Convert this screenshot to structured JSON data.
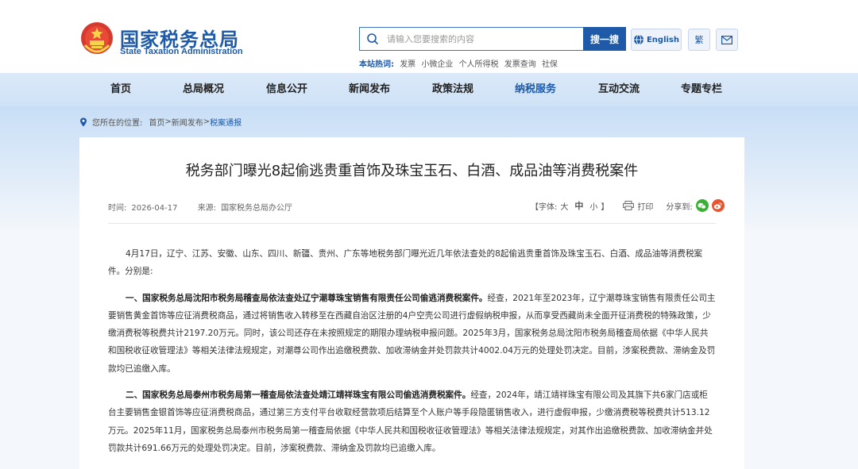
{
  "header": {
    "logo_cn": "国家税务总局",
    "logo_en": "State Taxation Administration",
    "search_placeholder": "请输入您要搜索的内容",
    "search_button": "搜一搜",
    "hot_label": "本站热词:",
    "hot_words": [
      "发票",
      "小微企业",
      "个人所得税",
      "发票查询",
      "社保"
    ],
    "lang_button": "English",
    "traditional_button": "繁"
  },
  "nav": {
    "items": [
      "首页",
      "总局概况",
      "信息公开",
      "新闻发布",
      "政策法规",
      "纳税服务",
      "互动交流",
      "专题专栏"
    ],
    "active_index": 5
  },
  "breadcrumb": {
    "prefix": "您所在的位置:",
    "home": "首页",
    "sep1": ">",
    "section": "新闻发布",
    "sep2": ">",
    "current": "税案通报"
  },
  "article": {
    "title": "税务部门曝光8起偷逃贵重首饰及珠宝玉石、白酒、成品油等消费税案件",
    "time_label": "时间:",
    "time": "2026-04-17",
    "source_label": "来源:",
    "source": "国家税务总局办公厅",
    "font_label_open": "【字体:",
    "font_big": "大",
    "font_mid": "中",
    "font_small": "小",
    "font_label_close": "】",
    "print": "打印",
    "share": "分享到:",
    "p1": "4月17日，辽宁、江苏、安徽、山东、四川、新疆、贵州、广东等地税务部门曝光近几年依法查处的8起偷逃贵重首饰及珠宝玉石、白酒、成品油等消费税案件。分别是:",
    "p2_bold": "一、国家税务总局沈阳市税务局稽查局依法查处辽宁潮尊珠宝销售有限责任公司偷逃消费税案件。",
    "p2_text": "经查，2021年至2023年，辽宁潮尊珠宝销售有限责任公司主要销售黄金首饰等应征消费税商品，通过将销售收入转移至在西藏自治区注册的4户空壳公司进行虚假纳税申报，从而享受西藏尚未全面开征消费税的特殊政策，少缴消费税等税费共计2197.20万元。同时，该公司还存在未按照规定的期限办理纳税申报问题。2025年3月，国家税务总局沈阳市税务局稽查局依据《中华人民共和国税收征收管理法》等相关法律法规规定，对潮尊公司作出追缴税费款、加收滞纳金并处罚款共计4002.04万元的处理处罚决定。目前，涉案税费款、滞纳金及罚款均已追缴入库。",
    "p3_bold": "二、国家税务总局泰州市税务局第一稽查局依法查处靖江靖祥珠宝有限公司偷逃消费税案件。",
    "p3_text": "经查，2024年，靖江靖祥珠宝有限公司及其旗下共6家门店或柜台主要销售金银首饰等应征消费税商品，通过第三方支付平台收取经营款项后结算至个人账户等手段隐匿销售收入，进行虚假申报，少缴消费税等税费共计513.12万元。2025年11月，国家税务总局泰州市税务局第一稽查局依据《中华人民共和国税收征收管理法》等相关法律法规规定，对其作出追缴税费款、加收滞纳金并处罚款共计691.66万元的处理处罚决定。目前，涉案税费款、滞纳金及罚款均已追缴入库。"
  },
  "colors": {
    "brand": "#1e5aa8",
    "nav_bg": "#d6e6f8",
    "wechat": "#3cb034",
    "weibo": "#e8542e"
  }
}
